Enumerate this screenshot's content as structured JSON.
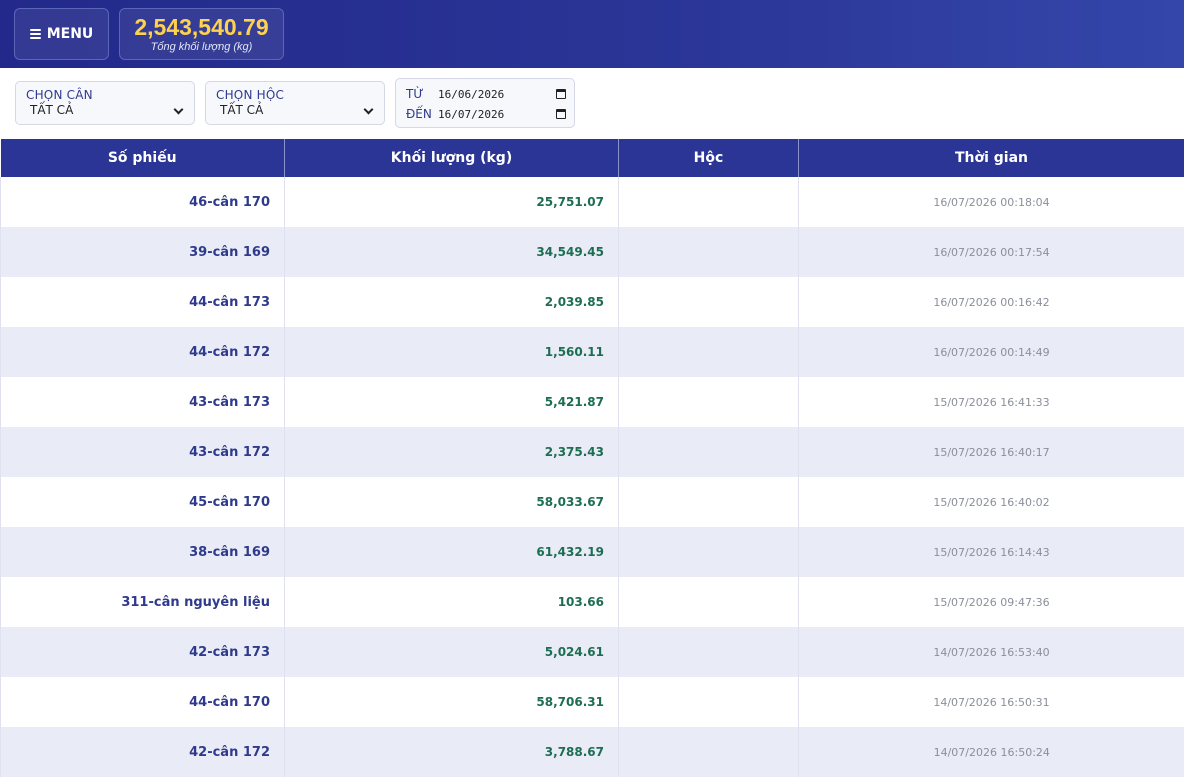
{
  "header": {
    "menu_label": "MENU",
    "total_value": "2,543,540.79",
    "total_label": "Tổng khối lượng (kg)"
  },
  "filters": {
    "scale": {
      "label": "CHỌN CÂN",
      "value": "TẤT CẢ"
    },
    "bin": {
      "label": "CHỌN HỘC",
      "value": "TẤT CẢ"
    },
    "date_from": {
      "label": "TỪ",
      "value": "16/06/2026"
    },
    "date_to": {
      "label": "ĐẾN",
      "value": "16/07/2026"
    }
  },
  "table": {
    "columns": [
      "Số phiếu",
      "Khối lượng (kg)",
      "Hộc",
      "Thời gian"
    ],
    "rows": [
      {
        "ticket": "46-cân 170",
        "weight": "25,751.07",
        "bin": "",
        "time": "16/07/2026 00:18:04"
      },
      {
        "ticket": "39-cân 169",
        "weight": "34,549.45",
        "bin": "",
        "time": "16/07/2026 00:17:54"
      },
      {
        "ticket": "44-cân 173",
        "weight": "2,039.85",
        "bin": "",
        "time": "16/07/2026 00:16:42"
      },
      {
        "ticket": "44-cân 172",
        "weight": "1,560.11",
        "bin": "",
        "time": "16/07/2026 00:14:49"
      },
      {
        "ticket": "43-cân 173",
        "weight": "5,421.87",
        "bin": "",
        "time": "15/07/2026 16:41:33"
      },
      {
        "ticket": "43-cân 172",
        "weight": "2,375.43",
        "bin": "",
        "time": "15/07/2026 16:40:17"
      },
      {
        "ticket": "45-cân 170",
        "weight": "58,033.67",
        "bin": "",
        "time": "15/07/2026 16:40:02"
      },
      {
        "ticket": "38-cân 169",
        "weight": "61,432.19",
        "bin": "",
        "time": "15/07/2026 16:14:43"
      },
      {
        "ticket": "311-cân nguyên liệu",
        "weight": "103.66",
        "bin": "",
        "time": "15/07/2026 09:47:36"
      },
      {
        "ticket": "42-cân 173",
        "weight": "5,024.61",
        "bin": "",
        "time": "14/07/2026 16:53:40"
      },
      {
        "ticket": "44-cân 170",
        "weight": "58,706.31",
        "bin": "",
        "time": "14/07/2026 16:50:31"
      },
      {
        "ticket": "42-cân 172",
        "weight": "3,788.67",
        "bin": "",
        "time": "14/07/2026 16:50:24"
      }
    ]
  }
}
